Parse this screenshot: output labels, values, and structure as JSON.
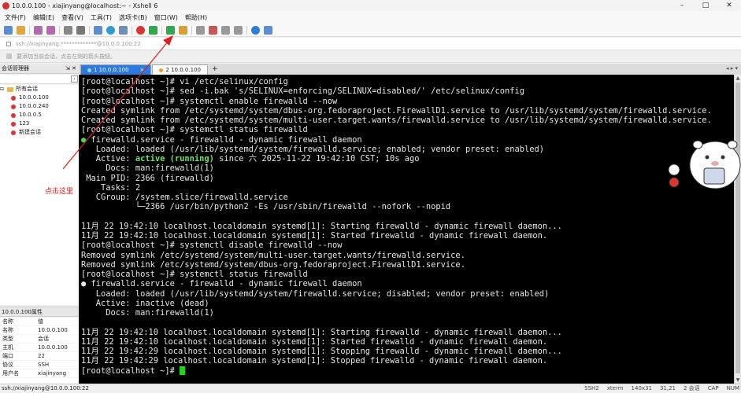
{
  "window": {
    "title": "10.0.0.100 - xiajinyang@localhost:~ - Xshell 6",
    "controls": [
      "–",
      "□",
      "✕"
    ]
  },
  "menu": [
    "文件(F)",
    "编辑(E)",
    "查看(V)",
    "工具(T)",
    "选项卡(B)",
    "窗口(W)",
    "帮助(H)"
  ],
  "address": "ssh://xiajinyang:*************@10.0.0.100:22",
  "hint": "要添加当前会话，点击左侧的箭头按钮。",
  "session_panel": {
    "title": "会话管理器",
    "pins": "⇲ ✕",
    "root": "所有会话",
    "items": [
      "10.0.0.100",
      "10.0.0.240",
      "10.0.0.5",
      "123",
      "新建会话"
    ]
  },
  "properties": {
    "title": "10.0.0.100属性",
    "header": {
      "k": "名称",
      "v": "值"
    },
    "rows": [
      {
        "k": "名称",
        "v": "10.0.0.100"
      },
      {
        "k": "类型",
        "v": "会话"
      },
      {
        "k": "主机",
        "v": "10.0.0.100"
      },
      {
        "k": "端口",
        "v": "22"
      },
      {
        "k": "协议",
        "v": "SSH"
      },
      {
        "k": "用户名",
        "v": "xiajinyang"
      }
    ]
  },
  "tabs": [
    {
      "label": "1 10.0.0.100",
      "active": true
    },
    {
      "label": "2 10.0.0.100",
      "active": false
    }
  ],
  "tab_add": "+",
  "annotation": "点击这里",
  "terminal": [
    {
      "t": "[root@localhost ~]# vi /etc/selinux/config"
    },
    {
      "t": "[root@localhost ~]# sed -i.bak 's/SELINUX=enforcing/SELINUX=disabled/' /etc/selinux/config"
    },
    {
      "t": "[root@localhost ~]# systemctl enable firewalld --now"
    },
    {
      "t": "Created symlink from /etc/systemd/system/dbus-org.fedoraproject.FirewallD1.service to /usr/lib/systemd/system/firewalld.service."
    },
    {
      "t": "Created symlink from /etc/systemd/system/multi-user.target.wants/firewalld.service to /usr/lib/systemd/system/firewalld.service."
    },
    {
      "t": "[root@localhost ~]# systemctl status firewalld"
    },
    {
      "dot": "green",
      "t": " firewalld.service - firewalld - dynamic firewall daemon"
    },
    {
      "t": "   Loaded: loaded (/usr/lib/systemd/system/firewalld.service; enabled; vendor preset: enabled)"
    },
    {
      "pre": "   Active: ",
      "hl": "active (running)",
      "t": " since 六 2025-11-22 19:42:10 CST; 10s ago"
    },
    {
      "t": "     Docs: man:firewalld(1)"
    },
    {
      "t": " Main PID: 2366 (firewalld)"
    },
    {
      "t": "    Tasks: 2"
    },
    {
      "t": "   CGroup: /system.slice/firewalld.service"
    },
    {
      "t": "           └─2366 /usr/bin/python2 -Es /usr/sbin/firewalld --nofork --nopid"
    },
    {
      "t": ""
    },
    {
      "t": "11月 22 19:42:10 localhost.localdomain systemd[1]: Starting firewalld - dynamic firewall daemon..."
    },
    {
      "t": "11月 22 19:42:10 localhost.localdomain systemd[1]: Started firewalld - dynamic firewall daemon."
    },
    {
      "t": "[root@localhost ~]# systemctl disable firewalld --now"
    },
    {
      "t": "Removed symlink /etc/systemd/system/multi-user.target.wants/firewalld.service."
    },
    {
      "t": "Removed symlink /etc/systemd/system/dbus-org.fedoraproject.FirewallD1.service."
    },
    {
      "t": "[root@localhost ~]# systemctl status firewalld"
    },
    {
      "dot": "white",
      "t": " firewalld.service - firewalld - dynamic firewall daemon"
    },
    {
      "t": "   Loaded: loaded (/usr/lib/systemd/system/firewalld.service; disabled; vendor preset: enabled)"
    },
    {
      "t": "   Active: inactive (dead)"
    },
    {
      "t": "     Docs: man:firewalld(1)"
    },
    {
      "t": ""
    },
    {
      "t": "11月 22 19:42:10 localhost.localdomain systemd[1]: Starting firewalld - dynamic firewall daemon..."
    },
    {
      "t": "11月 22 19:42:10 localhost.localdomain systemd[1]: Started firewalld - dynamic firewall daemon."
    },
    {
      "t": "11月 22 19:42:29 localhost.localdomain systemd[1]: Stopping firewalld - dynamic firewall daemon..."
    },
    {
      "t": "11月 22 19:42:29 localhost.localdomain systemd[1]: Stopped firewalld - dynamic firewall daemon."
    },
    {
      "t": "[root@localhost ~]# ",
      "cursor": true
    }
  ],
  "status": {
    "left": "ssh://xiajinyang@10.0.0.100:22",
    "right": [
      "SSH2",
      "xterm",
      "140x31",
      "31,21",
      "2 会话",
      "CAP",
      "NUM"
    ]
  },
  "colors": {
    "accent": "#2a7ae2",
    "terminal_bg": "#000000",
    "annotation": "#e02020"
  }
}
